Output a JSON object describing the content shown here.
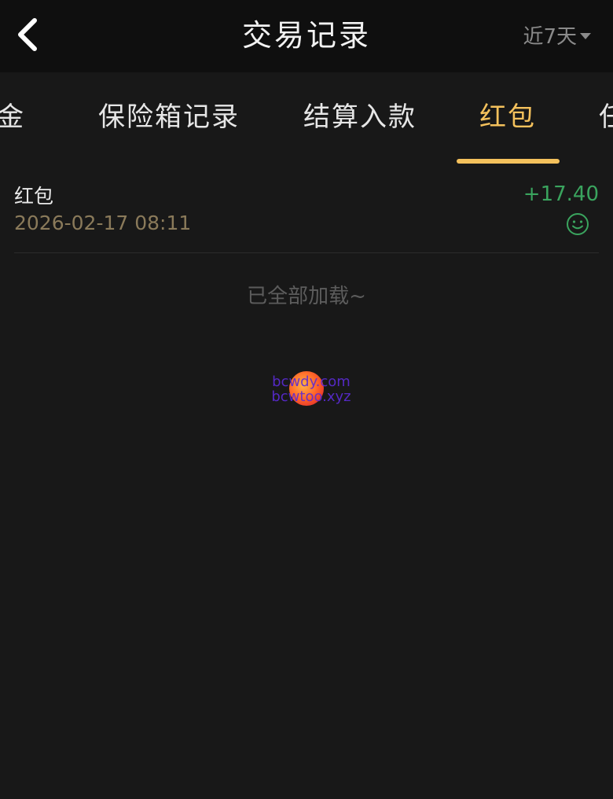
{
  "header": {
    "title": "交易记录",
    "range_label": "近7天"
  },
  "tabs": [
    {
      "label": "佣金",
      "visible_text": "用金"
    },
    {
      "label": "保险箱记录"
    },
    {
      "label": "结算入款"
    },
    {
      "label": "红包",
      "active": true
    },
    {
      "label": "任",
      "partial": true
    }
  ],
  "records": [
    {
      "title": "红包",
      "time": "2026-02-17 08:11",
      "amount": "+17.40",
      "icon": "smile-icon"
    }
  ],
  "footer": {
    "load_complete": "已全部加载~"
  },
  "watermark": {
    "line1": "bcwdy.com",
    "line2": "bcwtoo.xyz"
  },
  "colors": {
    "accent": "#f4c15c",
    "positive": "#3aa45e",
    "background": "#181818",
    "header_bg": "#0f0f0f"
  }
}
